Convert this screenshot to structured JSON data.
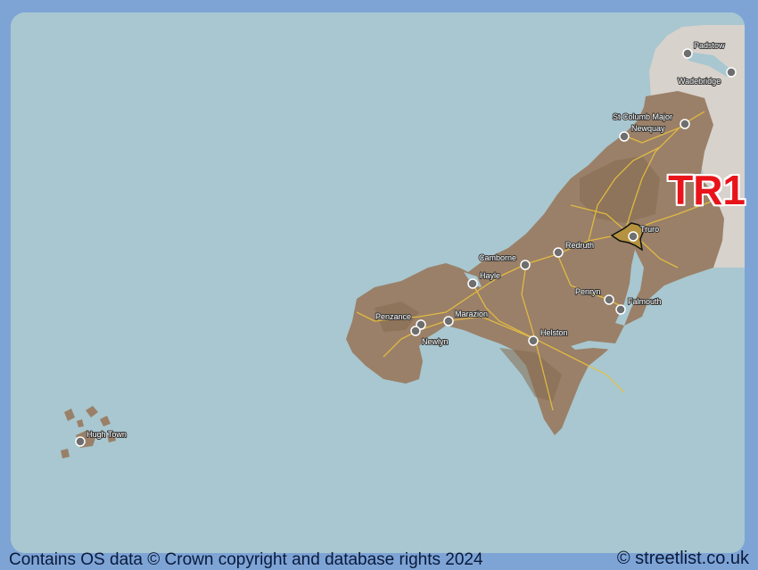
{
  "map": {
    "postcode": "TR1",
    "colors": {
      "sea": "#a8c7d0",
      "land": "#9a8068",
      "other_land": "#d8d2cc",
      "roads": "#e8c040",
      "frame": "#7ea4d6",
      "highlight": "#e8141a"
    },
    "towns": [
      {
        "id": "padstow",
        "label": "Padstow"
      },
      {
        "id": "wadebridge",
        "label": "Wadebridge"
      },
      {
        "id": "st-columb-major",
        "label": "St Columb Major"
      },
      {
        "id": "newquay",
        "label": "Newquay"
      },
      {
        "id": "truro",
        "label": "Truro"
      },
      {
        "id": "redruth",
        "label": "Redruth"
      },
      {
        "id": "camborne",
        "label": "Camborne"
      },
      {
        "id": "hayle",
        "label": "Hayle"
      },
      {
        "id": "penryn",
        "label": "Penryn"
      },
      {
        "id": "falmouth",
        "label": "Falmouth"
      },
      {
        "id": "penzance",
        "label": "Penzance"
      },
      {
        "id": "marazion",
        "label": "Marazion"
      },
      {
        "id": "newlyn",
        "label": "Newlyn"
      },
      {
        "id": "helston",
        "label": "Helston"
      },
      {
        "id": "hugh-town",
        "label": "Hugh Town"
      }
    ]
  },
  "footer": {
    "attribution": "Contains OS data © Crown copyright and database rights 2024",
    "site": "© streetlist.co.uk"
  }
}
